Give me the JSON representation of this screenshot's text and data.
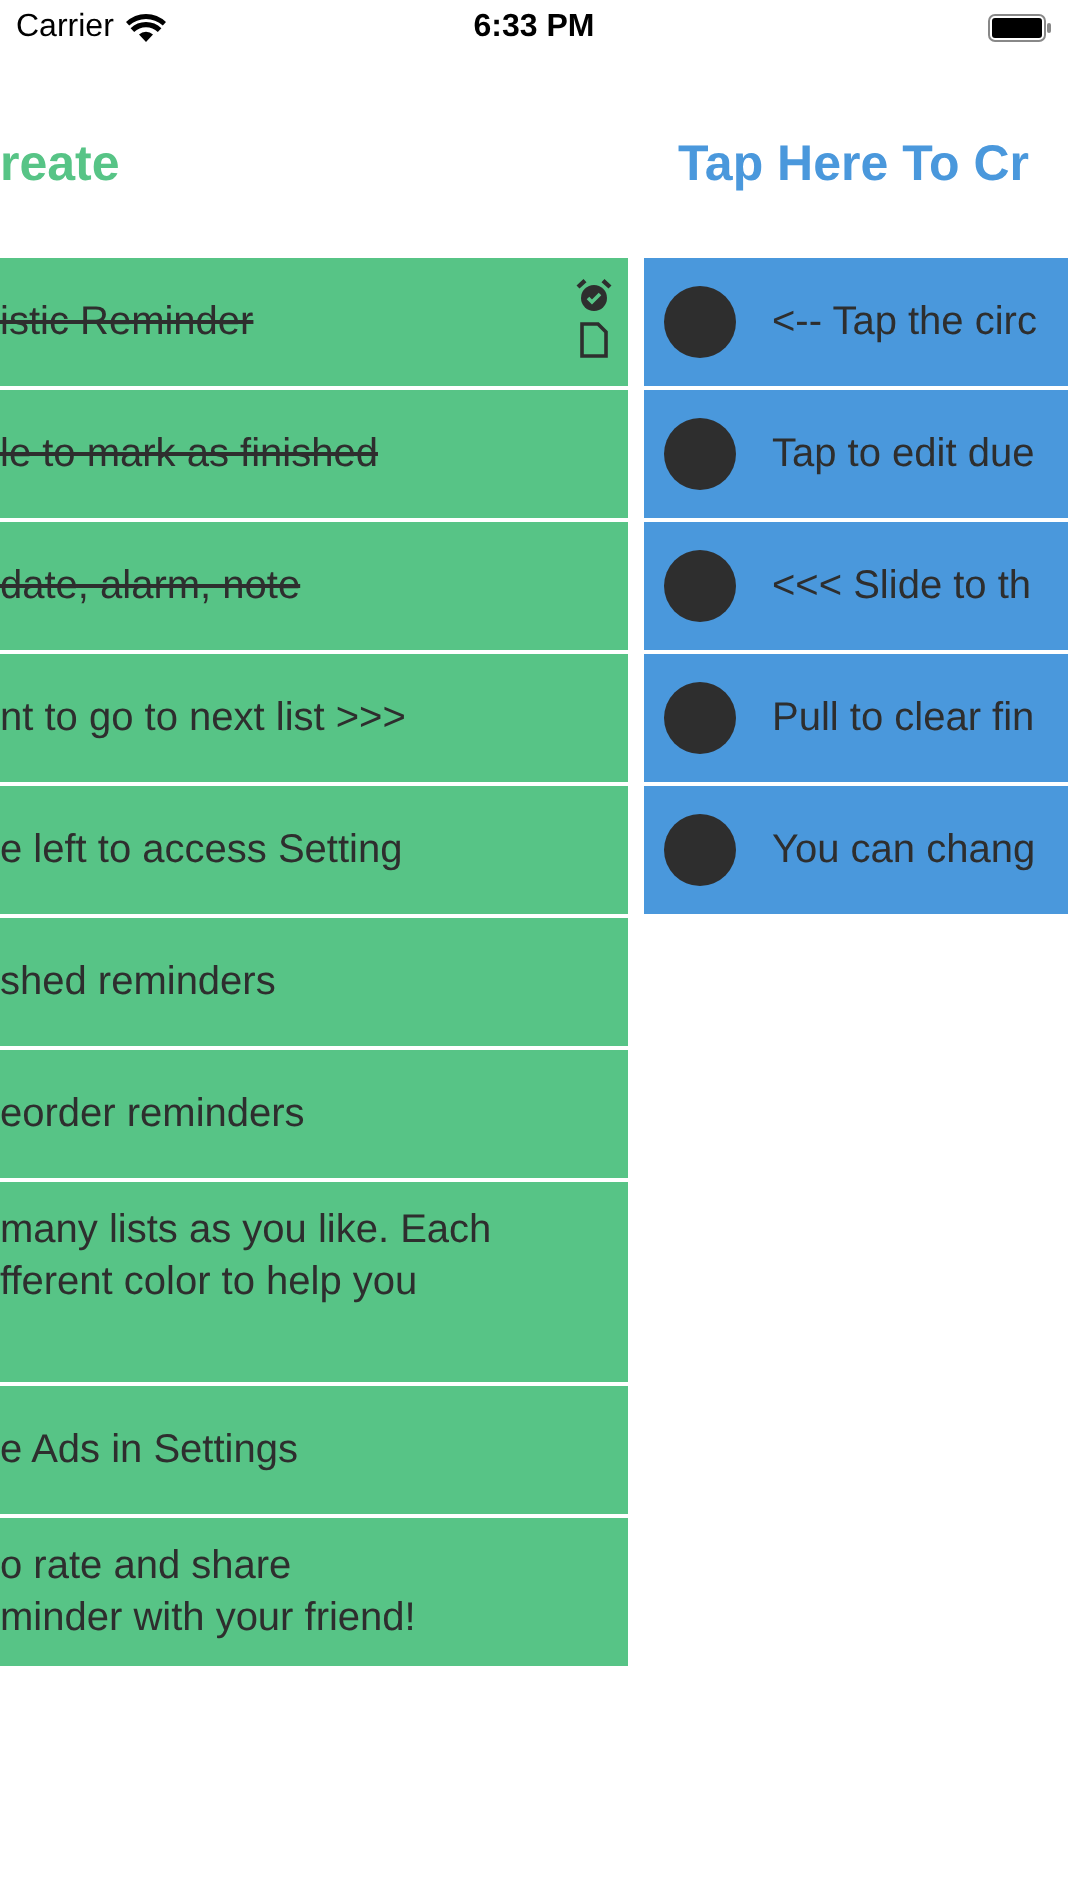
{
  "status_bar": {
    "carrier": "Carrier",
    "time": "6:33 PM"
  },
  "lists": [
    {
      "title": "reate",
      "color": "#57c486",
      "kind": "plain",
      "items": [
        {
          "text": "istic Reminder",
          "finished": true,
          "alarm": true,
          "note": true
        },
        {
          "text": "le to mark as finished",
          "finished": true,
          "alarm": false,
          "note": false
        },
        {
          "text": "date, alarm, note",
          "finished": true,
          "alarm": false,
          "note": false
        },
        {
          "text": "nt to go to next list >>>",
          "finished": false,
          "alarm": false,
          "note": false
        },
        {
          "text": "e left to access Setting",
          "finished": false,
          "alarm": false,
          "note": false
        },
        {
          "text": "shed reminders",
          "finished": false,
          "alarm": false,
          "note": false
        },
        {
          "text": "eorder reminders",
          "finished": false,
          "alarm": false,
          "note": false
        },
        {
          "text": "many lists as you like. Each\nfferent color to help you\n ",
          "finished": false,
          "alarm": false,
          "note": false
        },
        {
          "text": "e Ads in Settings",
          "finished": false,
          "alarm": false,
          "note": false
        },
        {
          "text": "o rate and share\nminder with your friend!",
          "finished": false,
          "alarm": false,
          "note": false
        }
      ]
    },
    {
      "title": "Tap Here To Cr",
      "color": "#4a98dc",
      "kind": "circles",
      "items": [
        {
          "text": "<-- Tap the circ",
          "finished": false,
          "alarm": false,
          "note": false
        },
        {
          "text": "Tap to edit due",
          "finished": false,
          "alarm": false,
          "note": false
        },
        {
          "text": "<<< Slide to th",
          "finished": false,
          "alarm": false,
          "note": false
        },
        {
          "text": "Pull to clear fin",
          "finished": false,
          "alarm": false,
          "note": false
        },
        {
          "text": "You can chang",
          "finished": false,
          "alarm": false,
          "note": false
        }
      ]
    }
  ]
}
